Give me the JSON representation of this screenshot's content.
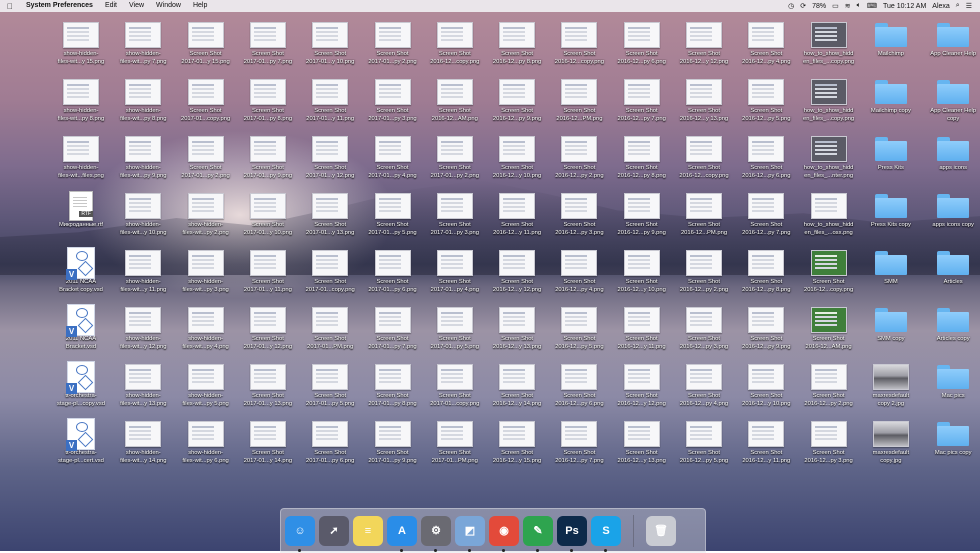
{
  "menubar": {
    "apple": "",
    "app_name": "System Preferences",
    "menus": [
      "Edit",
      "View",
      "Window",
      "Help"
    ],
    "battery": "78%",
    "clock": "Tue 10:12 AM",
    "user": "Alexa"
  },
  "desktop": {
    "columns": [
      {
        "items": [
          {
            "line1": "show-hidden-",
            "line2": "files-wit...y 15.png",
            "kind": "shot"
          },
          {
            "line1": "show-hidden-",
            "line2": "files-wit...py 8.png",
            "kind": "shot"
          },
          {
            "line1": "show-hidden-",
            "line2": "files-wit...files.png",
            "kind": "shot"
          },
          {
            "line1": "Микроданные.rtf",
            "line2": "",
            "kind": "rtf"
          },
          {
            "line1": "2011 NCAA",
            "line2": "Bracket copy.vsd",
            "kind": "vsd"
          },
          {
            "line1": "2011 NCAA",
            "line2": "Bracket.vsd",
            "kind": "vsd"
          },
          {
            "line1": "tt-orchestra-",
            "line2": "stage-pl...copy.vsd",
            "kind": "vsd"
          },
          {
            "line1": "tt-orchestra-",
            "line2": "stage-pl...cert.vsd",
            "kind": "vsd"
          }
        ]
      },
      {
        "items": [
          {
            "line1": "show-hidden-",
            "line2": "files-wit...py 7.png",
            "kind": "shot"
          },
          {
            "line1": "show-hidden-",
            "line2": "files-wit...py 8.png",
            "kind": "shot"
          },
          {
            "line1": "show-hidden-",
            "line2": "files-wit...py 9.png",
            "kind": "shot"
          },
          {
            "line1": "show-hidden-",
            "line2": "files-wit...y 10.png",
            "kind": "shot"
          },
          {
            "line1": "show-hidden-",
            "line2": "files-wit...y 11.png",
            "kind": "shot"
          },
          {
            "line1": "show-hidden-",
            "line2": "files-wit...y 12.png",
            "kind": "shot"
          },
          {
            "line1": "show-hidden-",
            "line2": "files-wit...y 13.png",
            "kind": "shot"
          },
          {
            "line1": "show-hidden-",
            "line2": "files-wit...y 14.png",
            "kind": "shot"
          }
        ]
      },
      {
        "items": [
          {
            "line1": "Screen Shot",
            "line2": "2017-01...y 15.png",
            "kind": "shot"
          },
          {
            "line1": "Screen Shot",
            "line2": "2017-01...copy.png",
            "kind": "shot"
          },
          {
            "line1": "Screen Shot",
            "line2": "2017-01...py 2.png",
            "kind": "shot"
          },
          {
            "line1": "show-hidden-",
            "line2": "files-wit...py 2.png",
            "kind": "shot"
          },
          {
            "line1": "show-hidden-",
            "line2": "files-wit...py 3.png",
            "kind": "shot"
          },
          {
            "line1": "show-hidden-",
            "line2": "files-wit...py 4.png",
            "kind": "shot"
          },
          {
            "line1": "show-hidden-",
            "line2": "files-wit...py 5.png",
            "kind": "shot"
          },
          {
            "line1": "show-hidden-",
            "line2": "files-wit...py 6.png",
            "kind": "shot"
          }
        ]
      },
      {
        "items": [
          {
            "line1": "Screen Shot",
            "line2": "2017-01...py 7.png",
            "kind": "shot"
          },
          {
            "line1": "Screen Shot",
            "line2": "2017-01...py 8.png",
            "kind": "shot"
          },
          {
            "line1": "Screen Shot",
            "line2": "2017-01...py 9.png",
            "kind": "shot"
          },
          {
            "line1": "Screen Shot",
            "line2": "2017-01...y 10.png",
            "kind": "shot"
          },
          {
            "line1": "Screen Shot",
            "line2": "2017-01...y 11.png",
            "kind": "shot"
          },
          {
            "line1": "Screen Shot",
            "line2": "2017-01...y 12.png",
            "kind": "shot"
          },
          {
            "line1": "Screen Shot",
            "line2": "2017-01...y 13.png",
            "kind": "shot"
          },
          {
            "line1": "Screen Shot",
            "line2": "2017-01...y 14.png",
            "kind": "shot"
          }
        ]
      },
      {
        "items": [
          {
            "line1": "Screen Shot",
            "line2": "2017-01...y 10.png",
            "kind": "shot"
          },
          {
            "line1": "Screen Shot",
            "line2": "2017-01...y 11.png",
            "kind": "shot"
          },
          {
            "line1": "Screen Shot",
            "line2": "2017-01...y 12.png",
            "kind": "shot"
          },
          {
            "line1": "Screen Shot",
            "line2": "2017-01...y 13.png",
            "kind": "shot"
          },
          {
            "line1": "Screen Shot",
            "line2": "2017-01...copy.png",
            "kind": "shot"
          },
          {
            "line1": "Screen Shot",
            "line2": "2017-01...PM.png",
            "kind": "shot"
          },
          {
            "line1": "Screen Shot",
            "line2": "2017-01...py 5.png",
            "kind": "shot"
          },
          {
            "line1": "Screen Shot",
            "line2": "2017-01...py 6.png",
            "kind": "shot"
          }
        ]
      },
      {
        "items": [
          {
            "line1": "Screen Shot",
            "line2": "2017-01...py 2.png",
            "kind": "shot"
          },
          {
            "line1": "Screen Shot",
            "line2": "2017-01...py 3.png",
            "kind": "shot"
          },
          {
            "line1": "Screen Shot",
            "line2": "2017-01...py 4.png",
            "kind": "shot"
          },
          {
            "line1": "Screen Shot",
            "line2": "2017-01...py 5.png",
            "kind": "shot"
          },
          {
            "line1": "Screen Shot",
            "line2": "2017-01...py 6.png",
            "kind": "shot"
          },
          {
            "line1": "Screen Shot",
            "line2": "2017-01...py 7.png",
            "kind": "shot"
          },
          {
            "line1": "Screen Shot",
            "line2": "2017-01...py 8.png",
            "kind": "shot"
          },
          {
            "line1": "Screen Shot",
            "line2": "2017-01...py 9.png",
            "kind": "shot"
          }
        ]
      },
      {
        "items": [
          {
            "line1": "Screen Shot",
            "line2": "2016-12...copy.png",
            "kind": "shot"
          },
          {
            "line1": "Screen Shot",
            "line2": "2016-12...AM.png",
            "kind": "shot"
          },
          {
            "line1": "Screen Shot",
            "line2": "2017-01...py 2.png",
            "kind": "shot"
          },
          {
            "line1": "Screen Shot",
            "line2": "2017-01...py 3.png",
            "kind": "shot"
          },
          {
            "line1": "Screen Shot",
            "line2": "2017-01...py 4.png",
            "kind": "shot"
          },
          {
            "line1": "Screen Shot",
            "line2": "2017-01...py 5.png",
            "kind": "shot"
          },
          {
            "line1": "Screen Shot",
            "line2": "2017-01...copy.png",
            "kind": "shot"
          },
          {
            "line1": "Screen Shot",
            "line2": "2017-01...PM.png",
            "kind": "shot"
          }
        ]
      },
      {
        "items": [
          {
            "line1": "Screen Shot",
            "line2": "2016-12...py 8.png",
            "kind": "shot"
          },
          {
            "line1": "Screen Shot",
            "line2": "2016-12...py 9.png",
            "kind": "shot"
          },
          {
            "line1": "Screen Shot",
            "line2": "2016-12...y 10.png",
            "kind": "shot"
          },
          {
            "line1": "Screen Shot",
            "line2": "2016-12...y 11.png",
            "kind": "shot"
          },
          {
            "line1": "Screen Shot",
            "line2": "2016-12...y 12.png",
            "kind": "shot"
          },
          {
            "line1": "Screen Shot",
            "line2": "2016-12...y 13.png",
            "kind": "shot"
          },
          {
            "line1": "Screen Shot",
            "line2": "2016-12...y 14.png",
            "kind": "shot"
          },
          {
            "line1": "Screen Shot",
            "line2": "2016-12...y 15.png",
            "kind": "shot"
          }
        ]
      },
      {
        "items": [
          {
            "line1": "Screen Shot",
            "line2": "2016-12...copy.png",
            "kind": "shot"
          },
          {
            "line1": "Screen Shot",
            "line2": "2016-12...PM.png",
            "kind": "shot"
          },
          {
            "line1": "Screen Shot",
            "line2": "2016-12...py 2.png",
            "kind": "shot"
          },
          {
            "line1": "Screen Shot",
            "line2": "2016-12...py 3.png",
            "kind": "shot"
          },
          {
            "line1": "Screen Shot",
            "line2": "2016-12...py 4.png",
            "kind": "shot"
          },
          {
            "line1": "Screen Shot",
            "line2": "2016-12...py 5.png",
            "kind": "shot"
          },
          {
            "line1": "Screen Shot",
            "line2": "2016-12...py 6.png",
            "kind": "shot"
          },
          {
            "line1": "Screen Shot",
            "line2": "2016-12...py 7.png",
            "kind": "shot"
          }
        ]
      },
      {
        "items": [
          {
            "line1": "Screen Shot",
            "line2": "2016-12...py 6.png",
            "kind": "shot"
          },
          {
            "line1": "Screen Shot",
            "line2": "2016-12...py 7.png",
            "kind": "shot"
          },
          {
            "line1": "Screen Shot",
            "line2": "2016-12...py 8.png",
            "kind": "shot"
          },
          {
            "line1": "Screen Shot",
            "line2": "2016-12...py 9.png",
            "kind": "shot"
          },
          {
            "line1": "Screen Shot",
            "line2": "2016-12...y 10.png",
            "kind": "shot"
          },
          {
            "line1": "Screen Shot",
            "line2": "2016-12...y 11.png",
            "kind": "shot"
          },
          {
            "line1": "Screen Shot",
            "line2": "2016-12...y 12.png",
            "kind": "shot"
          },
          {
            "line1": "Screen Shot",
            "line2": "2016-12...y 13.png",
            "kind": "shot"
          }
        ]
      },
      {
        "items": [
          {
            "line1": "Screen Shot",
            "line2": "2016-12...y 12.png",
            "kind": "shot"
          },
          {
            "line1": "Screen Shot",
            "line2": "2016-12...y 13.png",
            "kind": "shot"
          },
          {
            "line1": "Screen Shot",
            "line2": "2016-12...copy.png",
            "kind": "shot"
          },
          {
            "line1": "Screen Shot",
            "line2": "2016-12...PM.png",
            "kind": "shot"
          },
          {
            "line1": "Screen Shot",
            "line2": "2016-12...py 2.png",
            "kind": "shot"
          },
          {
            "line1": "Screen Shot",
            "line2": "2016-12...py 3.png",
            "kind": "shot"
          },
          {
            "line1": "Screen Shot",
            "line2": "2016-12...py 4.png",
            "kind": "shot"
          },
          {
            "line1": "Screen Shot",
            "line2": "2016-12...py 5.png",
            "kind": "shot"
          }
        ]
      },
      {
        "items": [
          {
            "line1": "Screen Shot",
            "line2": "2016-12...py 4.png",
            "kind": "shot"
          },
          {
            "line1": "Screen Shot",
            "line2": "2016-12...py 5.png",
            "kind": "shot"
          },
          {
            "line1": "Screen Shot",
            "line2": "2016-12...py 6.png",
            "kind": "shot"
          },
          {
            "line1": "Screen Shot",
            "line2": "2016-12...py 7.png",
            "kind": "shot"
          },
          {
            "line1": "Screen Shot",
            "line2": "2016-12...py 8.png",
            "kind": "shot"
          },
          {
            "line1": "Screen Shot",
            "line2": "2016-12...py 9.png",
            "kind": "shot"
          },
          {
            "line1": "Screen Shot",
            "line2": "2016-12...y 10.png",
            "kind": "shot"
          },
          {
            "line1": "Screen Shot",
            "line2": "2016-12...y 11.png",
            "kind": "shot"
          }
        ]
      },
      {
        "items": [
          {
            "line1": "how_to_show_hidd",
            "line2": "en_files_...copy.png",
            "kind": "dark"
          },
          {
            "line1": "how_to_show_hidd",
            "line2": "en_files_...copy.png",
            "kind": "dark"
          },
          {
            "line1": "how_to_show_hidd",
            "line2": "en_files_...nter.png",
            "kind": "dark"
          },
          {
            "line1": "how_to_show_hidd",
            "line2": "en_files_...osx.png",
            "kind": "shot"
          },
          {
            "line1": "Screen Shot",
            "line2": "2016-12...copy.png",
            "kind": "green"
          },
          {
            "line1": "Screen Shot",
            "line2": "2016-12...AM.png",
            "kind": "green"
          },
          {
            "line1": "Screen Shot",
            "line2": "2016-12...py 2.png",
            "kind": "shot"
          },
          {
            "line1": "Screen Shot",
            "line2": "2016-12...py 3.png",
            "kind": "shot"
          }
        ]
      },
      {
        "items": [
          {
            "line1": "Mailchimp",
            "line2": "",
            "kind": "folder"
          },
          {
            "line1": "Mailchimp copy",
            "line2": "",
            "kind": "folder"
          },
          {
            "line1": "Press Kits",
            "line2": "",
            "kind": "folder"
          },
          {
            "line1": "Press Kits copy",
            "line2": "",
            "kind": "folder"
          },
          {
            "line1": "SMM",
            "line2": "",
            "kind": "folder"
          },
          {
            "line1": "SMM copy",
            "line2": "",
            "kind": "folder"
          },
          {
            "line1": "maxresdefault",
            "line2": "copy 2.jpg",
            "kind": "photo"
          },
          {
            "line1": "maxresdefault",
            "line2": "copy.jpg",
            "kind": "photo"
          }
        ]
      },
      {
        "items": [
          {
            "line1": "App Cleaner Help",
            "line2": "",
            "kind": "folder"
          },
          {
            "line1": "App Cleaner Help",
            "line2": "copy",
            "kind": "folder"
          },
          {
            "line1": "apps icons",
            "line2": "",
            "kind": "folder"
          },
          {
            "line1": "apps icons copy",
            "line2": "",
            "kind": "folder"
          },
          {
            "line1": "Articles",
            "line2": "",
            "kind": "folder"
          },
          {
            "line1": "Articles copy",
            "line2": "",
            "kind": "folder"
          },
          {
            "line1": "Mac pics",
            "line2": "",
            "kind": "folder"
          },
          {
            "line1": "Mac pics copy",
            "line2": "",
            "kind": "folder"
          }
        ]
      }
    ]
  },
  "dock": {
    "apps": [
      {
        "icon": "finder-icon",
        "color": "#2f8fe6",
        "glyph": "☺",
        "running": true
      },
      {
        "icon": "launchpad-icon",
        "color": "#5a5a6a",
        "glyph": "➚",
        "running": false
      },
      {
        "icon": "notes-icon",
        "color": "#f2d65a",
        "glyph": "≡",
        "running": false
      },
      {
        "icon": "app-store-icon",
        "color": "#2a8de8",
        "glyph": "A",
        "running": true
      },
      {
        "icon": "system-preferences-icon",
        "color": "#6a6a72",
        "glyph": "⚙",
        "running": true
      },
      {
        "icon": "preview-icon",
        "color": "#7aa6d8",
        "glyph": "◩",
        "running": true
      },
      {
        "icon": "chrome-icon",
        "color": "#e34a3a",
        "glyph": "◉",
        "running": true
      },
      {
        "icon": "evernote-icon",
        "color": "#2ea44f",
        "glyph": "✎",
        "running": true
      },
      {
        "icon": "photoshop-icon",
        "color": "#0d2a4a",
        "glyph": "Ps",
        "running": true
      },
      {
        "icon": "skype-icon",
        "color": "#1aa3e8",
        "glyph": "S",
        "running": true
      },
      {
        "icon": "trash-icon",
        "color": "#c9cbd2",
        "glyph": "🗑",
        "running": false
      }
    ]
  }
}
